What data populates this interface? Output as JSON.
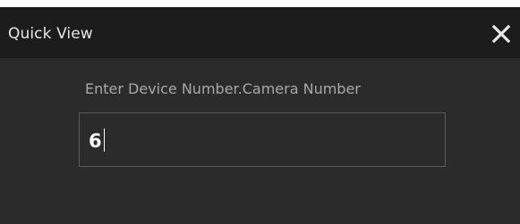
{
  "dialog": {
    "title": "Quick View",
    "close_icon": "close-icon",
    "prompt": "Enter Device Number.Camera Number",
    "input": {
      "value": "6"
    }
  },
  "colors": {
    "titlebar": "#1c1c1c",
    "body": "#2b2b2b",
    "text": "#e6e6e6",
    "prompt_text": "#a8a8a8",
    "input_border": "#5a5a5a"
  }
}
